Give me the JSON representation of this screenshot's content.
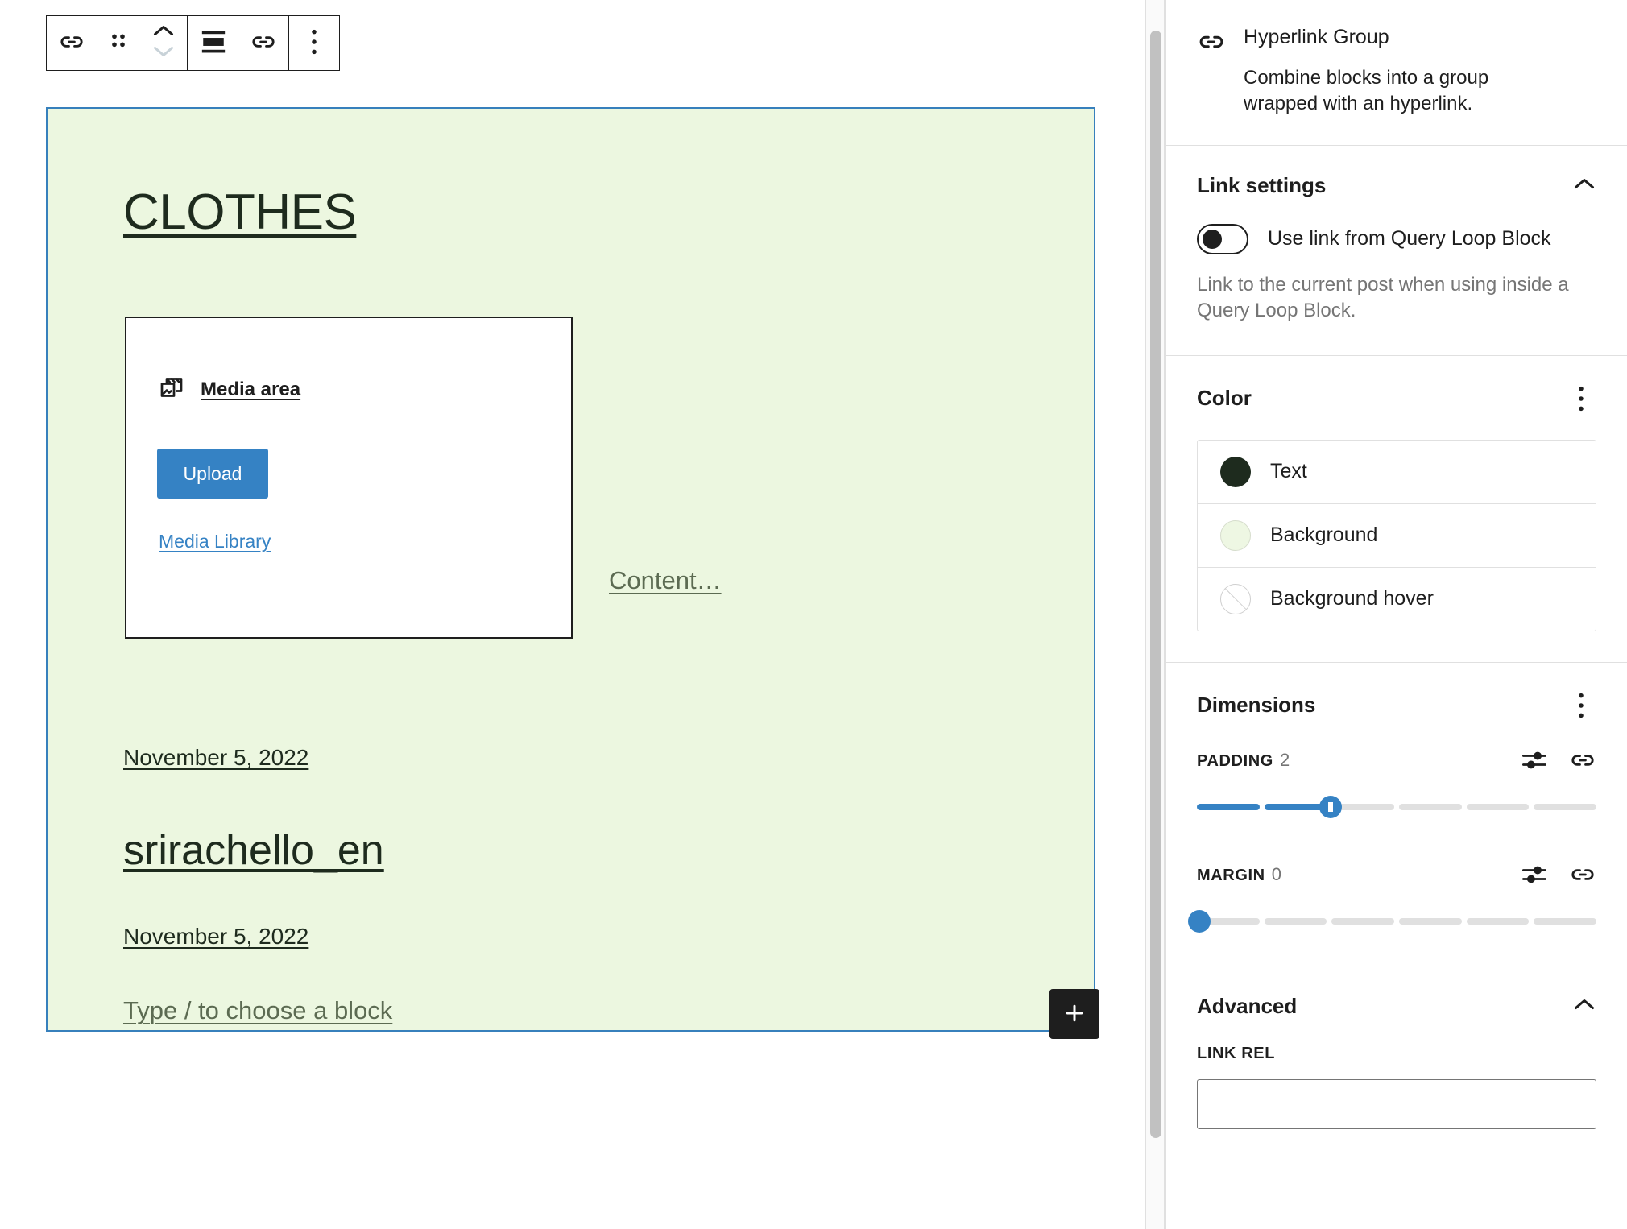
{
  "toolbar": {
    "items": [
      {
        "icon": "link-block-icon",
        "name": "block-type-link-icon",
        "label": "Hyperlink Group"
      },
      {
        "icon": "drag-handle-icon",
        "name": "drag-handle",
        "label": "Drag"
      },
      {
        "icon": "move-updown-icon",
        "name": "move-up-down",
        "label": "Move up / Move down"
      },
      {
        "icon": "align-icon",
        "name": "align-button",
        "label": "Align"
      },
      {
        "icon": "link-icon",
        "name": "link-button",
        "label": "Link"
      },
      {
        "icon": "more-vertical-icon",
        "name": "options-button",
        "label": "Options"
      }
    ]
  },
  "canvas": {
    "heading": "CLOTHES",
    "media_placeholder": {
      "label": "Media area",
      "icon": "media-gallery-icon",
      "upload_button": "Upload",
      "media_library_link": "Media Library"
    },
    "content_placeholder": "Content…",
    "date_first": "November 5, 2022",
    "username_heading": "srirachello_en",
    "date_second": "November 5, 2022",
    "block_placeholder": "Type / to choose a block",
    "appender_label": "+",
    "block_background": "#ecf7e0",
    "selection_border": "#3780bc"
  },
  "sidebar": {
    "block_card": {
      "icon": "link-block-icon",
      "title": "Hyperlink Group",
      "description": "Combine blocks into a group wrapped with an hyperlink."
    },
    "link_settings": {
      "title": "Link settings",
      "chevron": "chevron-up-icon",
      "toggle_label": "Use link from Query Loop Block",
      "toggle_on": false,
      "help": "Link to the current post when using inside a Query Loop Block."
    },
    "color": {
      "title": "Color",
      "menu_icon": "more-vertical-icon",
      "rows": [
        {
          "label": "Text",
          "swatch": "#1e2b1e",
          "style": "solid"
        },
        {
          "label": "Background",
          "swatch": "#eef7e3",
          "style": "bordered"
        },
        {
          "label": "Background hover",
          "swatch": "",
          "style": "empty"
        }
      ]
    },
    "dimensions": {
      "title": "Dimensions",
      "menu_icon": "more-vertical-icon",
      "padding": {
        "label": "Padding",
        "value": "2",
        "segments": 6,
        "filled": 2,
        "thumb_percent": 33,
        "settings_icon": "sliders-icon",
        "link_icon": "link-icon"
      },
      "margin": {
        "label": "Margin",
        "value": "0",
        "segments": 6,
        "filled": 0,
        "thumb_percent": 0,
        "settings_icon": "sliders-icon",
        "link_icon": "link-icon"
      }
    },
    "advanced": {
      "title": "Advanced",
      "chevron": "chevron-up-icon",
      "link_rel_label": "Link rel",
      "link_rel_value": "",
      "link_rel_placeholder": ""
    }
  }
}
